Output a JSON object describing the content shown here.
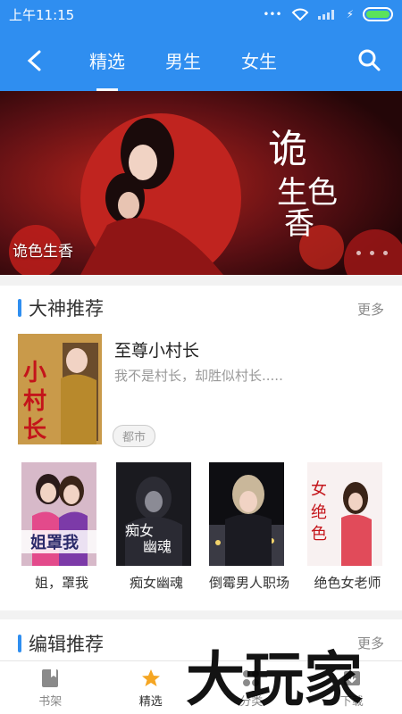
{
  "status": {
    "time": "上午11:15"
  },
  "nav": {
    "tabs": [
      "精选",
      "男生",
      "女生"
    ],
    "active_tab": 0
  },
  "banner": {
    "caption": "诡色生香",
    "artwork_title": "诡色生香"
  },
  "section1": {
    "title": "大神推荐",
    "more": "更多",
    "feature": {
      "title": "至尊小村长",
      "desc": "我不是村长，却胜似村长.....",
      "tag": "都市",
      "cover_text": "小村长"
    },
    "books": [
      {
        "name": "姐，罩我",
        "cover_text": "姐罩我"
      },
      {
        "name": "痴女幽魂",
        "cover_text": "痴女幽魂"
      },
      {
        "name": "倒霉男人职场",
        "cover_text": ""
      },
      {
        "name": "绝色女老师",
        "cover_text": "绝色女老师"
      }
    ]
  },
  "section2": {
    "title": "编辑推荐",
    "more": "更多"
  },
  "bottom_nav": {
    "items": [
      "书架",
      "精选",
      "分类",
      "下载"
    ],
    "active": 1
  },
  "watermark": "大玩家",
  "colors": {
    "primary": "#2f8ef0",
    "active_star": "#f5a623"
  }
}
